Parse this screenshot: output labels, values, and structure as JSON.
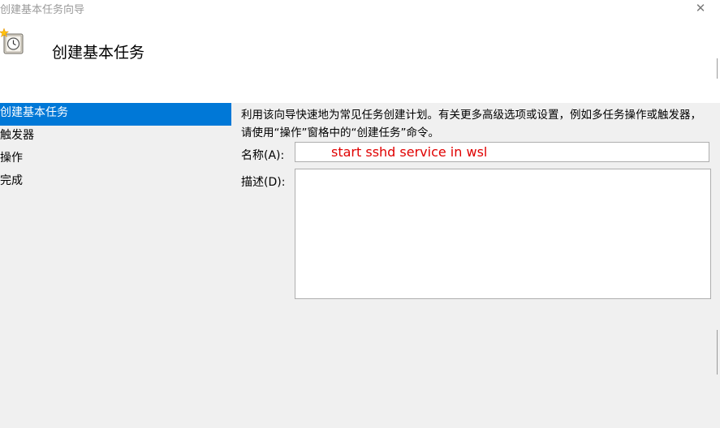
{
  "window": {
    "title": "创建基本任务向导",
    "close_glyph": "✕"
  },
  "header": {
    "icon": "scheduled-task-clock-icon",
    "title": "创建基本任务"
  },
  "nav": {
    "items": [
      {
        "label": "创建基本任务",
        "selected": true
      },
      {
        "label": "触发器",
        "selected": false
      },
      {
        "label": "操作",
        "selected": false
      },
      {
        "label": "完成",
        "selected": false
      }
    ]
  },
  "content": {
    "description": "利用该向导快速地为常见任务创建计划。有关更多高级选项或设置，例如多任务操作或触发器，请使用“操作”窗格中的“创建任务”命令。",
    "name_label": "名称(A):",
    "name_value": "start sshd service in wsl",
    "desc_label": "描述(D):",
    "desc_value": ""
  },
  "colors": {
    "accent": "#0078d7",
    "name_text": "#e00000",
    "background": "#f0f0f0"
  }
}
